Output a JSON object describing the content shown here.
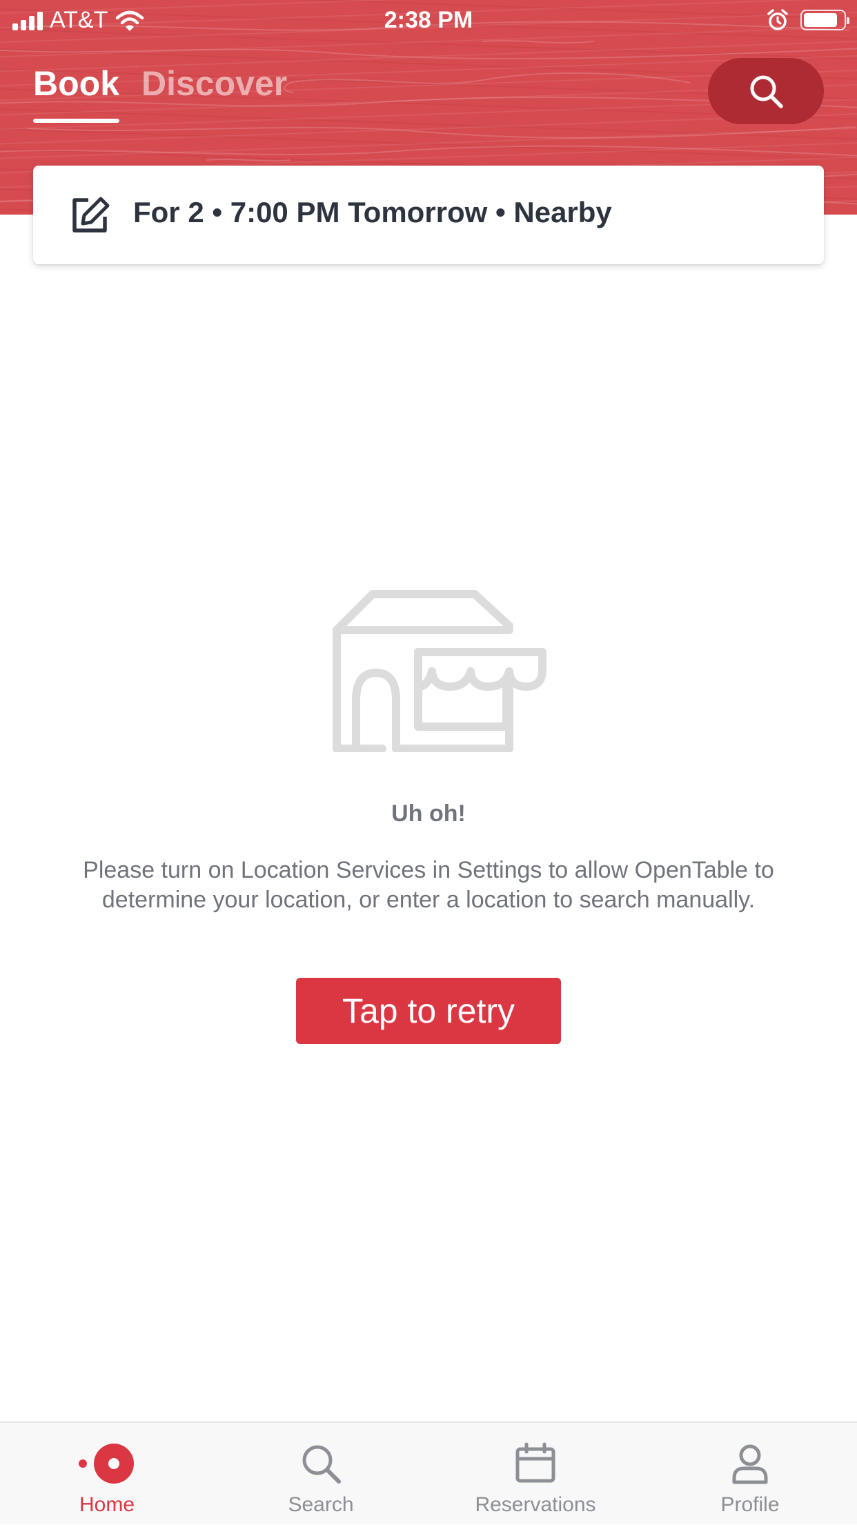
{
  "colors": {
    "brand_red": "#da3743",
    "header_red": "#d64b50",
    "search_pill": "#ae2b33",
    "text_dark": "#2d333f",
    "text_muted": "#6f737b",
    "tab_inactive": "#8c8f95"
  },
  "status_bar": {
    "carrier": "AT&T",
    "time": "2:38 PM",
    "battery_level": 0.85,
    "icons": [
      "signal-icon",
      "wifi-icon",
      "alarm-icon",
      "battery-icon"
    ]
  },
  "header": {
    "tabs": [
      {
        "label": "Book",
        "active": true
      },
      {
        "label": "Discover",
        "active": false
      }
    ],
    "search_icon": "search-icon"
  },
  "criteria": {
    "icon": "edit-icon",
    "text": "For 2 • 7:00 PM Tomorrow • Nearby"
  },
  "empty_state": {
    "icon": "restaurant-storefront-icon",
    "title": "Uh oh!",
    "message": "Please turn on Location Services in Settings to allow OpenTable to determine your location, or enter a location to search manually.",
    "retry_label": "Tap to retry"
  },
  "tab_bar": {
    "items": [
      {
        "label": "Home",
        "icon": "home-icon",
        "active": true
      },
      {
        "label": "Search",
        "icon": "search-icon",
        "active": false
      },
      {
        "label": "Reservations",
        "icon": "calendar-icon",
        "active": false
      },
      {
        "label": "Profile",
        "icon": "profile-icon",
        "active": false
      }
    ]
  }
}
